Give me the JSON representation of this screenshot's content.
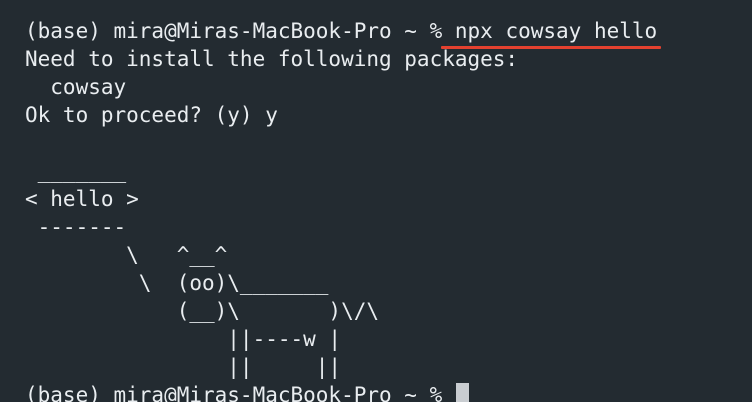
{
  "terminal": {
    "prompt": "(base) mira@Miras-MacBook-Pro ~ % ",
    "command": "npx cowsay hello",
    "output": [
      "Need to install the following packages:",
      "  cowsay",
      "Ok to proceed? (y) y",
      "",
      " _______",
      "< hello >",
      " -------",
      "        \\   ^__^",
      "         \\  (oo)\\_______",
      "            (__)\\       )\\/\\",
      "                ||----w |",
      "                ||     ||"
    ],
    "final_prompt": "(base) mira@Miras-MacBook-Pro ~ % "
  },
  "colors": {
    "background": "#232b31",
    "text": "#e9edf0",
    "highlight_underline": "#e4412f",
    "cursor": "#c9cdd1"
  }
}
